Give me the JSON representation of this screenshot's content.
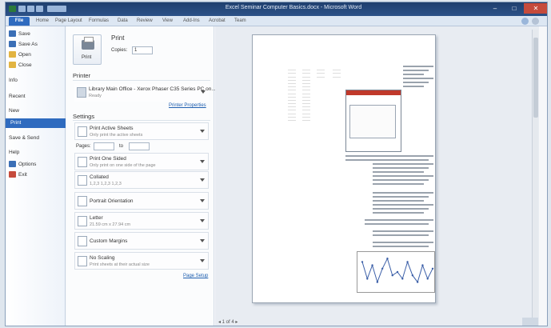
{
  "window": {
    "title": "Excel Seminar Computer Basics.docx - Microsoft Word",
    "close_label": "✕",
    "min_label": "–",
    "max_label": "□"
  },
  "ribbon": {
    "file_tab": "File",
    "tabs": [
      "Home",
      "Page Layout",
      "Formulas",
      "Data",
      "Review",
      "View",
      "Add-Ins",
      "Acrobat",
      "Team"
    ]
  },
  "nav": {
    "items": [
      {
        "label": "Save",
        "icon": "save-icon",
        "color": "#3b6fb6"
      },
      {
        "label": "Save As",
        "icon": "save-as-icon",
        "color": "#3b6fb6"
      },
      {
        "label": "Open",
        "icon": "open-folder-icon",
        "color": "#e2b441"
      },
      {
        "label": "Close",
        "icon": "close-folder-icon",
        "color": "#e2b441"
      },
      {
        "label": "Info",
        "icon": "",
        "color": ""
      },
      {
        "label": "Recent",
        "icon": "",
        "color": ""
      },
      {
        "label": "New",
        "icon": "",
        "color": ""
      },
      {
        "label": "Print",
        "icon": "",
        "color": ""
      },
      {
        "label": "Save & Send",
        "icon": "",
        "color": ""
      },
      {
        "label": "Help",
        "icon": "",
        "color": ""
      },
      {
        "label": "Options",
        "icon": "options-icon",
        "color": "#3b6fb6"
      },
      {
        "label": "Exit",
        "icon": "exit-icon",
        "color": "#c64b3c"
      }
    ],
    "active_index": 7
  },
  "print": {
    "heading": "Print",
    "copies_label": "Copies:",
    "copies_value": "1",
    "button_label": "Print"
  },
  "printer": {
    "heading": "Printer",
    "name": "Library Main Office - Xerox Phaser C35 Series PC on...",
    "status": "Ready",
    "properties_link": "Printer Properties"
  },
  "settings": {
    "heading": "Settings",
    "pages_label": "Pages:",
    "to_label": "to",
    "rows": [
      {
        "title": "Print Active Sheets",
        "subtitle": "Only print the active sheets"
      },
      {
        "title": "Print One Sided",
        "subtitle": "Only print on one side of the page"
      },
      {
        "title": "Collated",
        "subtitle": "1,2,3   1,2,3   1,2,3"
      },
      {
        "title": "Portrait Orientation",
        "subtitle": ""
      },
      {
        "title": "Letter",
        "subtitle": "21.59 cm x 27.94 cm"
      },
      {
        "title": "Custom Margins",
        "subtitle": ""
      },
      {
        "title": "No Scaling",
        "subtitle": "Print sheets at their actual size"
      }
    ],
    "page_setup_link": "Page Setup"
  },
  "preview": {
    "pager": "◂  1   of 4  ▸",
    "page_num": "1",
    "table_rows": 16
  },
  "chart_data": {
    "type": "line",
    "x": [
      1,
      2,
      3,
      4,
      5,
      6,
      7,
      8,
      9,
      10,
      11,
      12,
      13,
      14,
      15
    ],
    "series": [
      {
        "values": [
          8,
          3,
          7,
          2,
          6,
          9,
          4,
          5,
          3,
          8,
          4,
          2,
          7,
          3,
          6
        ]
      }
    ],
    "ylim": [
      0,
      10
    ]
  }
}
